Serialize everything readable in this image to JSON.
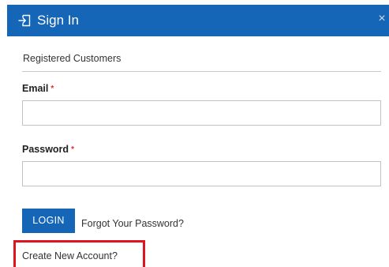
{
  "header": {
    "title": "Sign In",
    "close_glyph": "×",
    "icon": "sign-in-icon",
    "background_color": "#1566b7"
  },
  "form": {
    "section_title": "Registered Customers",
    "email": {
      "label": "Email",
      "required_mark": "*",
      "value": "",
      "placeholder": ""
    },
    "password": {
      "label": "Password",
      "required_mark": "*",
      "value": "",
      "placeholder": ""
    },
    "login_label": "LOGIN",
    "forgot_label": "Forgot Your Password?",
    "create_account_label": "Create New Account?"
  },
  "highlight_color": "#e0141d"
}
